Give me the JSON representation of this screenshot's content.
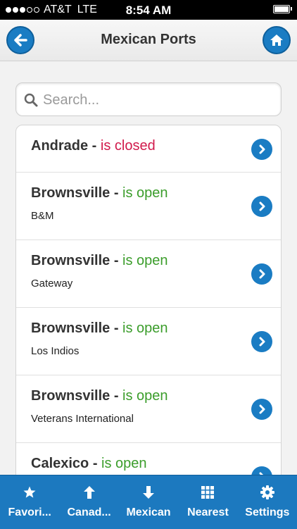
{
  "status_bar": {
    "carrier": "AT&T",
    "network": "LTE",
    "time": "8:54 AM"
  },
  "header": {
    "title": "Mexican Ports",
    "back_icon": "back-arrow-icon",
    "home_icon": "home-icon"
  },
  "search": {
    "placeholder": "Search..."
  },
  "ports": [
    {
      "name": "Andrade",
      "separator": " - ",
      "status": "is closed",
      "sublabel": ""
    },
    {
      "name": "Brownsville",
      "separator": " - ",
      "status": "is open",
      "sublabel": "B&M"
    },
    {
      "name": "Brownsville",
      "separator": " - ",
      "status": "is open",
      "sublabel": "Gateway"
    },
    {
      "name": "Brownsville",
      "separator": " - ",
      "status": "is open",
      "sublabel": "Los Indios"
    },
    {
      "name": "Brownsville",
      "separator": " - ",
      "status": "is open",
      "sublabel": "Veterans International"
    },
    {
      "name": "Calexico",
      "separator": " - ",
      "status": "is open",
      "sublabel": ""
    }
  ],
  "tabs": [
    {
      "label": "Favori...",
      "icon": "star-icon"
    },
    {
      "label": "Canad...",
      "icon": "arrow-up-icon"
    },
    {
      "label": "Mexican",
      "icon": "arrow-down-icon"
    },
    {
      "label": "Nearest",
      "icon": "grid-icon"
    },
    {
      "label": "Settings",
      "icon": "gear-icon"
    }
  ],
  "colors": {
    "accent": "#1a7cc3",
    "open": "#3b9d2b",
    "closed": "#d11a4c"
  }
}
